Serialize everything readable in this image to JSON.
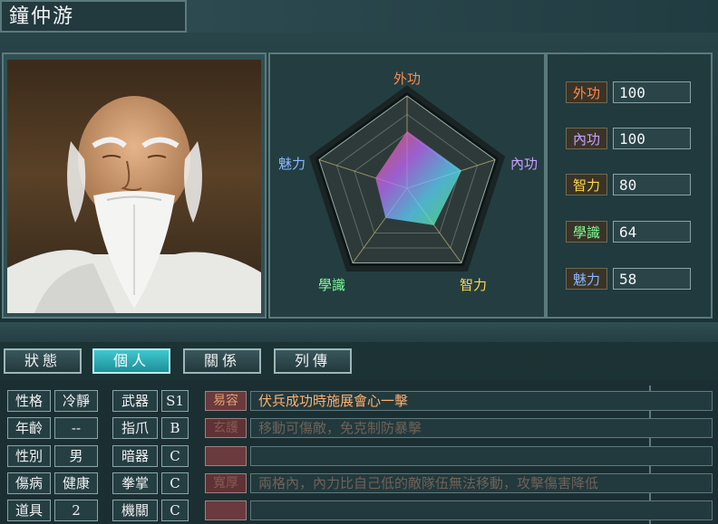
{
  "character": {
    "name": "鐘仲游"
  },
  "radar": {
    "axes": [
      {
        "label": "外功",
        "value": 100
      },
      {
        "label": "內功",
        "value": 100
      },
      {
        "label": "智力",
        "value": 80
      },
      {
        "label": "學識",
        "value": 64
      },
      {
        "label": "魅力",
        "value": 58
      }
    ],
    "max": 100
  },
  "stats": [
    {
      "label": "外功",
      "value": "100",
      "color": "#ff8a4a"
    },
    {
      "label": "內功",
      "value": "100",
      "color": "#c9a0ff"
    },
    {
      "label": "智力",
      "value": "80",
      "color": "#ffd84a"
    },
    {
      "label": "學識",
      "value": "64",
      "color": "#7fff9a"
    },
    {
      "label": "魅力",
      "value": "58",
      "color": "#8ab8ff"
    }
  ],
  "tabs": [
    {
      "label": "狀態",
      "active": false
    },
    {
      "label": "個人",
      "active": true
    },
    {
      "label": "關係",
      "active": false
    },
    {
      "label": "列傳",
      "active": false
    }
  ],
  "attributes": [
    {
      "label": "性格",
      "value": "冷靜"
    },
    {
      "label": "年齡",
      "value": "--"
    },
    {
      "label": "性別",
      "value": "男"
    },
    {
      "label": "傷病",
      "value": "健康"
    },
    {
      "label": "道具",
      "value": "2"
    }
  ],
  "weapons": [
    {
      "label": "武器",
      "grade": "S1"
    },
    {
      "label": "指爪",
      "grade": "B"
    },
    {
      "label": "暗器",
      "grade": "C"
    },
    {
      "label": "拳掌",
      "grade": "C"
    },
    {
      "label": "機關",
      "grade": "C"
    }
  ],
  "skills": [
    {
      "name": "易容",
      "desc": "伏兵成功時施展會心一擊",
      "dim": false
    },
    {
      "name": "玄護",
      "desc": "移動可傷敵，免克制防暴擊",
      "dim": true
    },
    {
      "name": "",
      "desc": "",
      "dim": false
    },
    {
      "name": "寬厚",
      "desc": "兩格內，內力比自己低的敵隊伍無法移動，攻擊傷害降低",
      "dim": true
    },
    {
      "name": "",
      "desc": "",
      "dim": false
    }
  ]
}
